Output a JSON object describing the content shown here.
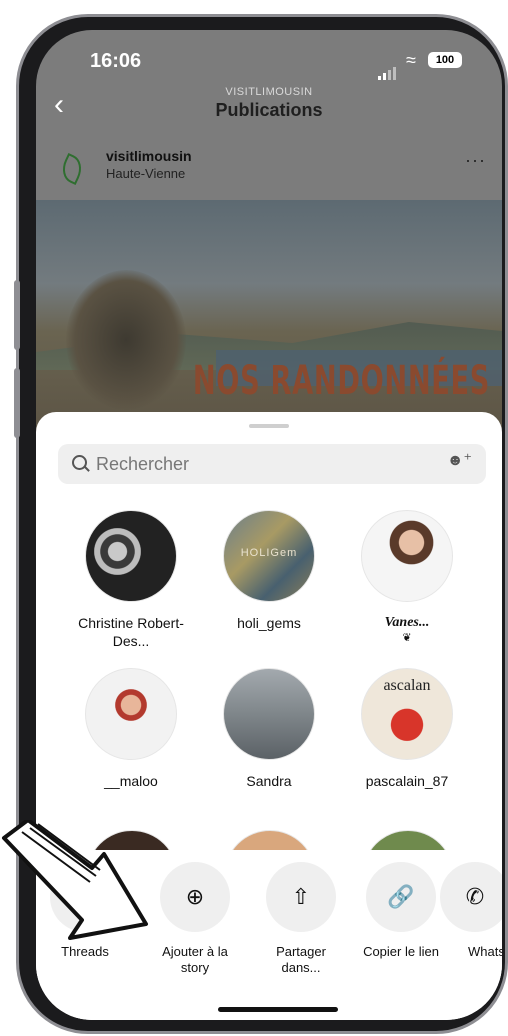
{
  "status_bar": {
    "time": "16:06",
    "battery": "100"
  },
  "header": {
    "subtitle": "VISITLIMOUSIN",
    "title": "Publications"
  },
  "post": {
    "username": "visitlimousin",
    "location": "Haute-Vienne",
    "image_text": "NOS RANDONNÉES"
  },
  "share_sheet": {
    "search_placeholder": "Rechercher",
    "contacts": [
      {
        "name": "Christine Robert-Des..."
      },
      {
        "name": "holi_gems",
        "avatar_text": "HOLIGem"
      },
      {
        "name": "Vanes...",
        "badge": "❦"
      },
      {
        "name": "__maloo"
      },
      {
        "name": "Sandra"
      },
      {
        "name": "pascalain_87",
        "avatar_text": "ascalan"
      }
    ],
    "actions": [
      {
        "label": "Threads",
        "icon": "threads-icon"
      },
      {
        "label": "Ajouter à la story",
        "icon": "add-story-icon"
      },
      {
        "label": "Partager dans...",
        "icon": "share-icon"
      },
      {
        "label": "Copier le lien",
        "icon": "link-icon"
      },
      {
        "label": "Whats",
        "icon": "whatsapp-icon"
      }
    ]
  },
  "colors": {
    "overlay": "#7c7c7c",
    "sheet": "#ffffff",
    "action_bg": "#efefef",
    "brand_leaf": "#2f6e30"
  }
}
